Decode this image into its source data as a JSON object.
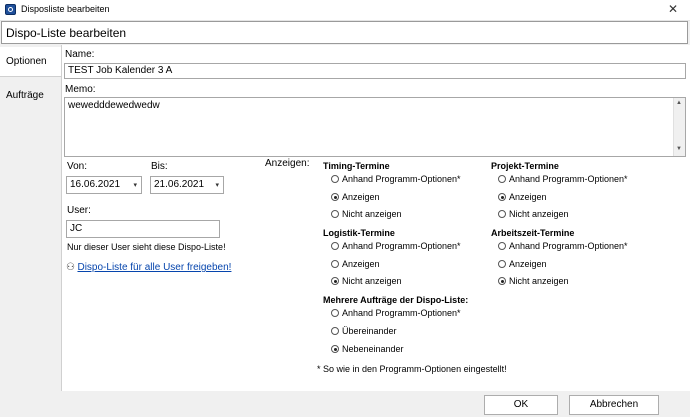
{
  "window": {
    "title": "Disposliste bearbeiten",
    "close_glyph": "✕"
  },
  "header": {
    "title": "Dispo-Liste bearbeiten"
  },
  "tabs": [
    {
      "label": "Optionen"
    },
    {
      "label": "Aufträge"
    }
  ],
  "form": {
    "name_label": "Name:",
    "name_value": "TEST Job Kalender 3 A",
    "memo_label": "Memo:",
    "memo_value": "wewedddewedwedw",
    "von_label": "Von:",
    "von_value": "16.06.2021",
    "bis_label": "Bis:",
    "bis_value": "21.06.2021",
    "user_label": "User:",
    "user_value": "JC",
    "user_note": "Nur dieser User sieht diese Dispo-Liste!",
    "share_link": "Dispo-Liste für alle User freigeben!"
  },
  "anzeigen": {
    "label": "Anzeigen:",
    "groups": {
      "timing": {
        "title": "Timing-Termine",
        "options": [
          "Anhand Programm-Optionen*",
          "Anzeigen",
          "Nicht anzeigen"
        ],
        "selected": 1
      },
      "projekt": {
        "title": "Projekt-Termine",
        "options": [
          "Anhand Programm-Optionen*",
          "Anzeigen",
          "Nicht anzeigen"
        ],
        "selected": 1
      },
      "logistik": {
        "title": "Logistik-Termine",
        "options": [
          "Anhand Programm-Optionen*",
          "Anzeigen",
          "Nicht anzeigen"
        ],
        "selected": 2
      },
      "arbeitszeit": {
        "title": "Arbeitszeit-Termine",
        "options": [
          "Anhand Programm-Optionen*",
          "Anzeigen",
          "Nicht anzeigen"
        ],
        "selected": 2
      },
      "mehrere": {
        "title": "Mehrere Aufträge der Dispo-Liste:",
        "options": [
          "Anhand Programm-Optionen*",
          "Übereinander",
          "Nebeneinander"
        ],
        "selected": 2
      }
    },
    "footnote": "* So wie in den Programm-Optionen eingestellt!"
  },
  "footer": {
    "ok_label": "OK",
    "cancel_label": "Abbrechen"
  }
}
